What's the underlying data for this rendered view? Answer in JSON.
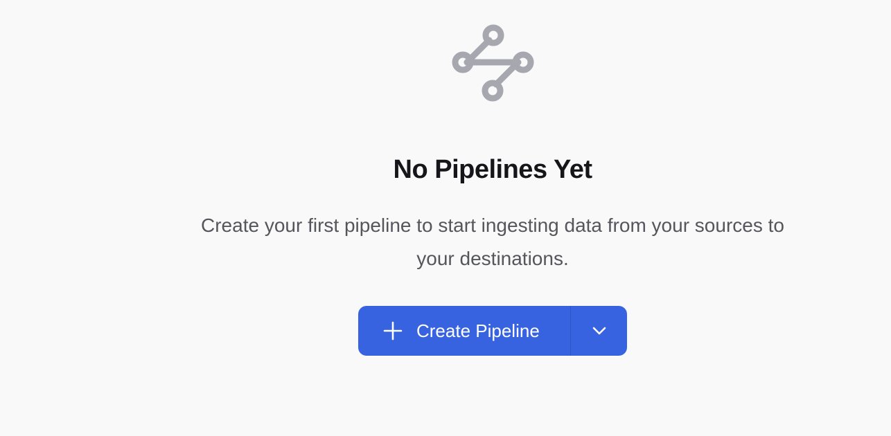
{
  "empty_state": {
    "icon": "pipeline-icon",
    "title": "No Pipelines Yet",
    "description": "Create your first pipeline to start ingesting data from your sources to your destinations."
  },
  "create_button": {
    "label": "Create Pipeline",
    "leading_icon": "plus-icon",
    "dropdown_icon": "chevron-down-icon"
  },
  "colors": {
    "background": "#f9f9fa",
    "icon": "#a7a7af",
    "title": "#16161a",
    "description": "#55555c",
    "button": "#3763e0"
  }
}
